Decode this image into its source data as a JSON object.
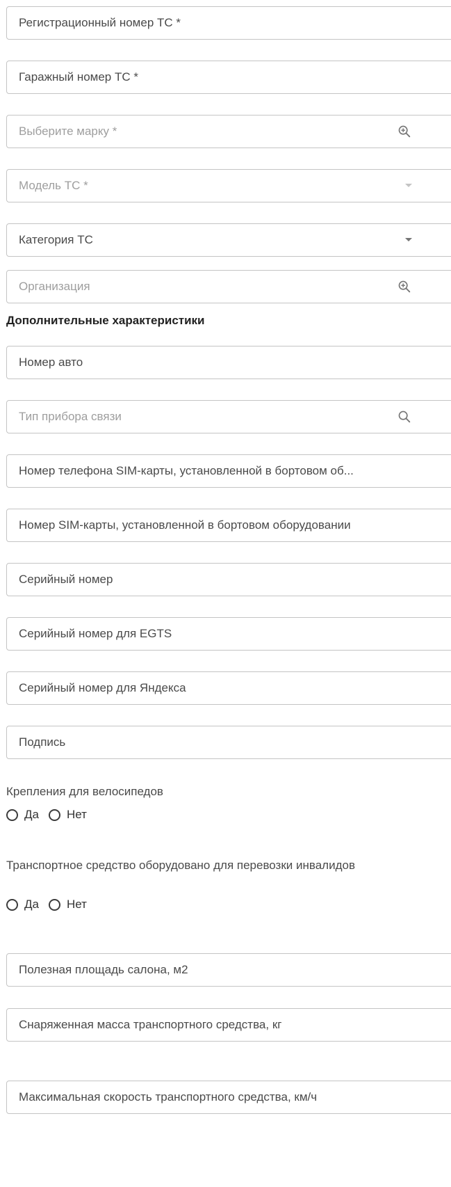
{
  "fields": [
    {
      "label": "Регистрационный номер ТС *",
      "icon": "none"
    },
    {
      "label": "Гаражный номер ТС *",
      "icon": "none"
    },
    {
      "label": "Выберите марку *",
      "icon": "zoom-in-icon"
    },
    {
      "label": "Модель ТС *",
      "icon": "dropdown-arrow-disabled"
    },
    {
      "label": "Категория ТС",
      "icon": "dropdown-arrow"
    },
    {
      "label": "Организация",
      "icon": "zoom-in-icon"
    },
    {
      "label": "Номер авто",
      "icon": "none"
    },
    {
      "label": "Тип прибора связи",
      "icon": "search-icon"
    },
    {
      "label": "Номер телефона SIM-карты, установленной в бортовом об...",
      "icon": "none"
    },
    {
      "label": "Номер SIM-карты, установленной в бортовом оборудовании",
      "icon": "none"
    },
    {
      "label": "Серийный номер",
      "icon": "none"
    },
    {
      "label": "Серийный номер для EGTS",
      "icon": "none"
    },
    {
      "label": "Серийный номер для Яндекса",
      "icon": "none"
    },
    {
      "label": "Подпись",
      "icon": "none"
    },
    {
      "label": "Полезная площадь салона, м2",
      "icon": "none"
    },
    {
      "label": "Снаряженная масса транспортного средства, кг",
      "icon": "none"
    },
    {
      "label": "Максимальная скорость транспортного средства, км/ч",
      "icon": "none"
    }
  ],
  "section_title": "Дополнительные характеристики",
  "bike_racks": {
    "label": "Крепления для велосипедов",
    "options": [
      "Да",
      "Нет"
    ]
  },
  "disabled_transport": {
    "label": "Транспортное средство оборудовано для перевозки инвалидов",
    "options": [
      "Да",
      "Нет"
    ]
  },
  "colors": {
    "border": "#c4c4c4",
    "text": "#4a4a4a",
    "placeholder": "#9e9e9e",
    "icon": "#757575"
  }
}
